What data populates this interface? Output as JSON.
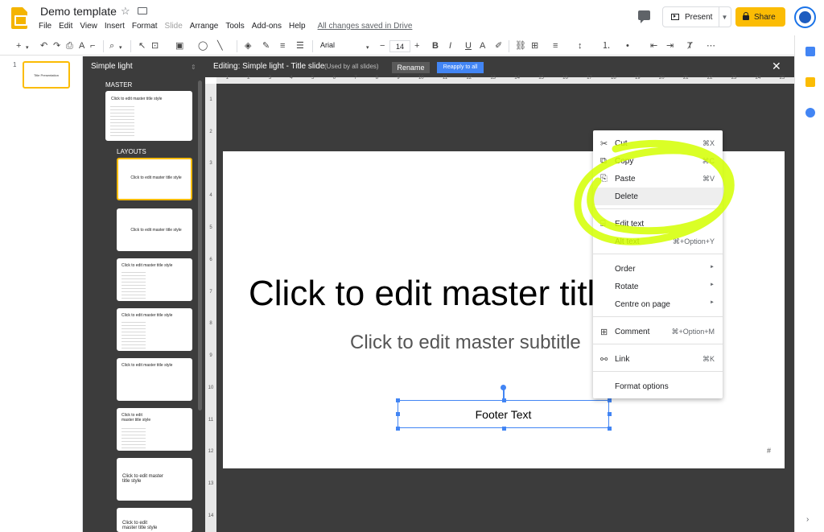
{
  "header": {
    "doc_title": "Demo template",
    "menu": [
      "File",
      "Edit",
      "View",
      "Insert",
      "Format",
      "Slide",
      "Arrange",
      "Tools",
      "Add-ons",
      "Help"
    ],
    "save_status": "All changes saved in Drive",
    "present_label": "Present",
    "share_label": "Share"
  },
  "toolbar": {
    "font": "Arial",
    "font_size": "14"
  },
  "filmstrip": {
    "slide_number": "1",
    "slide_title": "Title Presentation"
  },
  "master_panel": {
    "name": "Simple light",
    "master_label": "MASTER",
    "layouts_label": "LAYOUTS",
    "thumb_master_title": "Click to edit master title style",
    "thumb_titles": [
      "Click to edit master title style",
      "Click to edit master title style",
      "Click to edit master title style",
      "Click to edit master title style",
      "Click to edit master title style",
      "Click to edit master title style",
      "Click to edit master title style",
      "Click to edit master title style"
    ]
  },
  "edit_bar": {
    "title": "Editing: Simple light - Title slide",
    "used_by": "(Used by all slides)",
    "rename_label": "Rename",
    "reapply_label": "Reapply to all"
  },
  "ruler": {
    "h_numbers": [
      "1",
      "2",
      "3",
      "4",
      "5",
      "6",
      "7",
      "8",
      "9",
      "10",
      "11",
      "12",
      "13",
      "14",
      "15",
      "16",
      "17",
      "18",
      "19",
      "20",
      "21",
      "22",
      "23",
      "24",
      "25"
    ],
    "v_numbers": [
      "1",
      "2",
      "3",
      "4",
      "5",
      "6",
      "7",
      "8",
      "9",
      "10",
      "11",
      "12",
      "13",
      "14"
    ]
  },
  "slide": {
    "title": "Click to edit master title style",
    "subtitle": "Click to edit master subtitle",
    "footer": "Footer Text",
    "number_placeholder": "#"
  },
  "context_menu": {
    "cut": {
      "label": "Cut",
      "shortcut": "⌘X"
    },
    "copy": {
      "label": "Copy",
      "shortcut": "⌘C"
    },
    "paste": {
      "label": "Paste",
      "shortcut": "⌘V"
    },
    "delete": {
      "label": "Delete"
    },
    "edit_text": {
      "label": "Edit text"
    },
    "alt_text": {
      "label": "Alt text",
      "shortcut": "⌘+Option+Y"
    },
    "order": {
      "label": "Order"
    },
    "rotate": {
      "label": "Rotate"
    },
    "centre": {
      "label": "Centre on page"
    },
    "comment": {
      "label": "Comment",
      "shortcut": "⌘+Option+M"
    },
    "link": {
      "label": "Link",
      "shortcut": "⌘K"
    },
    "format_options": {
      "label": "Format options"
    }
  },
  "colors": {
    "accent_yellow": "#fbbc04",
    "selection_blue": "#4285f4",
    "dark_panel": "#3c3c3c",
    "highlight_green": "#d4ff00"
  }
}
